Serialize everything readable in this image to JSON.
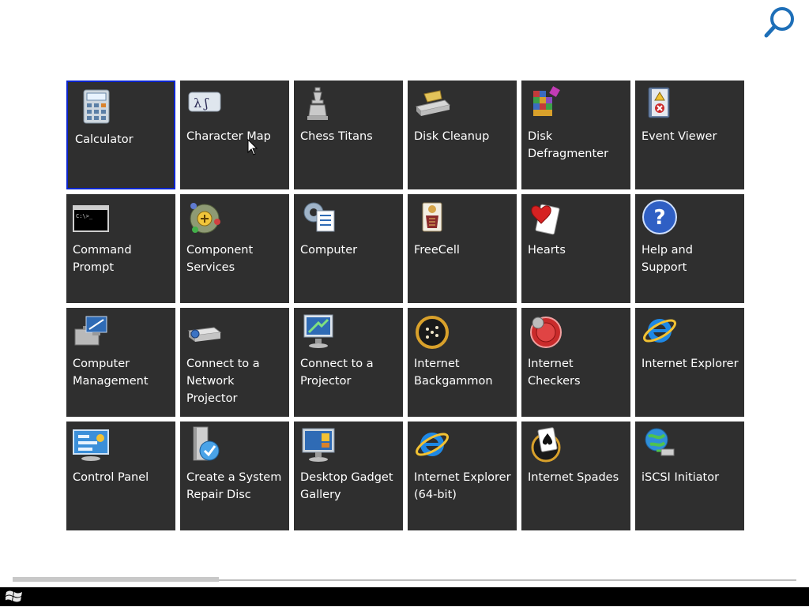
{
  "search": {
    "icon": "search-icon"
  },
  "tiles": [
    {
      "label": "Calculator",
      "icon": "calculator-icon",
      "selected": true
    },
    {
      "label": "Character Map",
      "icon": "character-map-icon"
    },
    {
      "label": "Chess Titans",
      "icon": "chess-icon"
    },
    {
      "label": "Disk Cleanup",
      "icon": "disk-cleanup-icon"
    },
    {
      "label": "Disk Defragmenter",
      "icon": "disk-defragmenter-icon"
    },
    {
      "label": "Event Viewer",
      "icon": "event-viewer-icon"
    },
    {
      "label": "Command Prompt",
      "icon": "command-prompt-icon"
    },
    {
      "label": "Component Services",
      "icon": "component-services-icon"
    },
    {
      "label": "Computer",
      "icon": "computer-icon"
    },
    {
      "label": "FreeCell",
      "icon": "freecell-icon"
    },
    {
      "label": "Hearts",
      "icon": "hearts-icon"
    },
    {
      "label": "Help and Support",
      "icon": "help-icon"
    },
    {
      "label": "Computer Management",
      "icon": "computer-management-icon"
    },
    {
      "label": "Connect to a Network Projector",
      "icon": "network-projector-icon"
    },
    {
      "label": "Connect to a Projector",
      "icon": "projector-icon"
    },
    {
      "label": "Internet Backgammon",
      "icon": "backgammon-icon"
    },
    {
      "label": "Internet Checkers",
      "icon": "checkers-icon"
    },
    {
      "label": "Internet Explorer",
      "icon": "internet-explorer-icon"
    },
    {
      "label": "Control Panel",
      "icon": "control-panel-icon"
    },
    {
      "label": "Create a System Repair Disc",
      "icon": "repair-disc-icon"
    },
    {
      "label": "Desktop Gadget Gallery",
      "icon": "gadget-gallery-icon"
    },
    {
      "label": "Internet Explorer (64-bit)",
      "icon": "internet-explorer-64-icon"
    },
    {
      "label": "Internet Spades",
      "icon": "spades-icon"
    },
    {
      "label": "iSCSI Initiator",
      "icon": "iscsi-icon"
    }
  ],
  "scroll": {
    "position": 0.0
  },
  "taskbar": {
    "start_icon": "windows-start-icon"
  },
  "colors": {
    "tile_bg": "#2f2f2f",
    "selection": "#0a24cf",
    "taskbar": "#000000",
    "accent": "#1e6fb8"
  }
}
